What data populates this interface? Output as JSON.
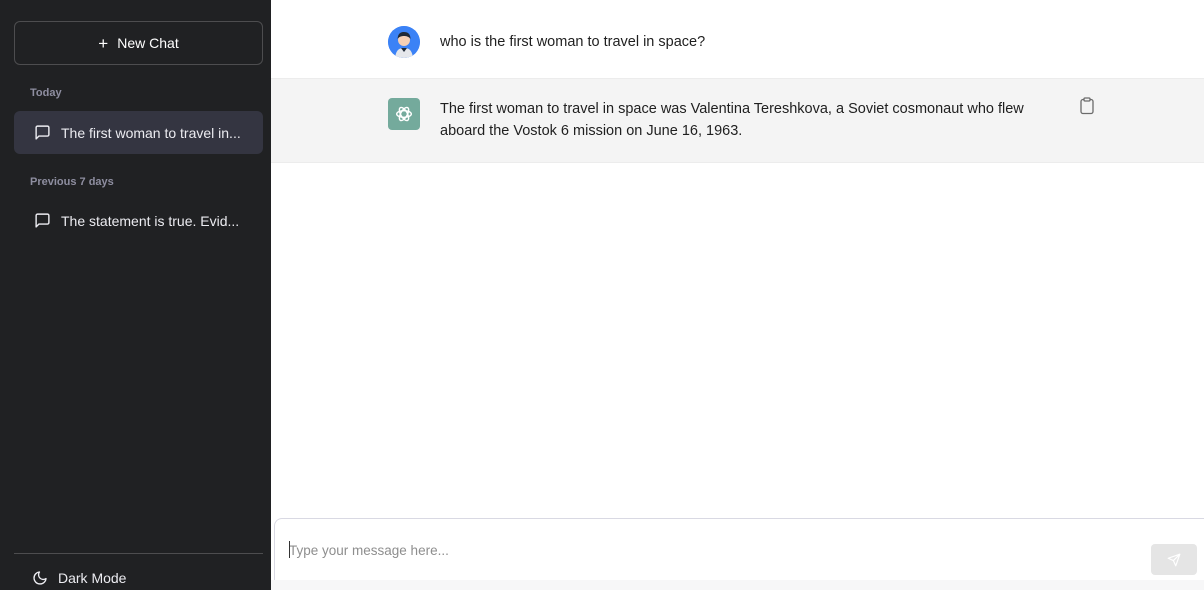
{
  "sidebar": {
    "new_chat_label": "New Chat",
    "new_chat_icon": "plus-icon",
    "sections": [
      {
        "label": "Today",
        "items": [
          {
            "label": "The first woman to travel in...",
            "active": true
          }
        ]
      },
      {
        "label": "Previous 7 days",
        "items": [
          {
            "label": "The statement is true. Evid...",
            "active": false
          }
        ]
      }
    ],
    "dark_mode_label": "Dark Mode"
  },
  "conversation": {
    "user_message": "who is the first woman to travel in space?",
    "assistant_message": "The first woman to travel in space was Valentina Tereshkova, a Soviet cosmonaut who flew aboard the Vostok 6 mission on June 16, 1963."
  },
  "composer": {
    "placeholder": "Type your message here...",
    "value": ""
  },
  "colors": {
    "sidebar_bg": "#202123",
    "active_item_bg": "#343541",
    "assistant_row_bg": "#f4f4f4",
    "assistant_avatar_bg": "#74aa9c",
    "user_avatar_bg": "#3b82f6"
  }
}
